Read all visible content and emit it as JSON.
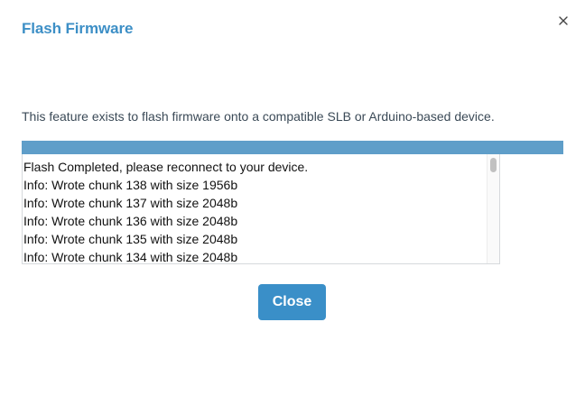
{
  "dialog": {
    "title": "Flash Firmware",
    "close_icon": "close-icon",
    "description": "This feature exists to flash firmware onto a compatible SLB or Arduino-based device.",
    "progress": {
      "percent": 100,
      "fill_color": "#5f9ec9"
    },
    "log_lines": [
      "Flash Completed, please reconnect to your device.",
      "Info: Wrote chunk 138 with size 1956b",
      "Info: Wrote chunk 137 with size 2048b",
      "Info: Wrote chunk 136 with size 2048b",
      "Info: Wrote chunk 135 with size 2048b",
      "Info: Wrote chunk 134 with size 2048b"
    ],
    "close_button_label": "Close",
    "accent_color": "#3a8fc8"
  }
}
